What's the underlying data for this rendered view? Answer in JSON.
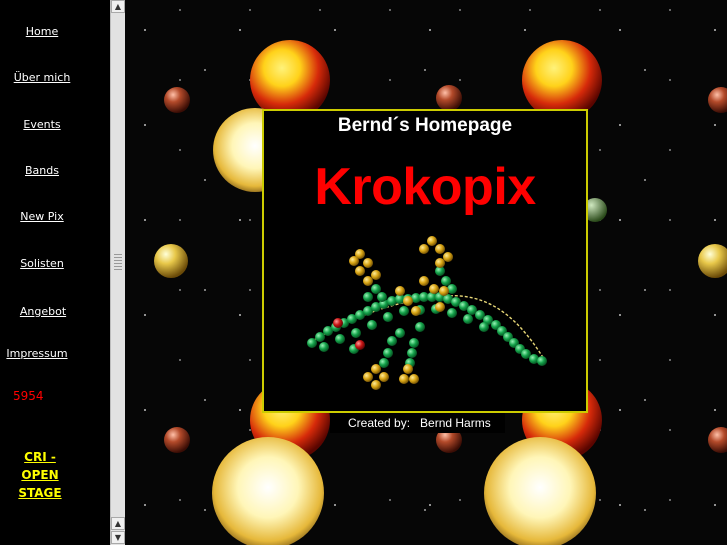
{
  "nav": {
    "items": [
      {
        "label": "Home"
      },
      {
        "label": "Über mich"
      },
      {
        "label": "Events"
      },
      {
        "label": "Bands"
      },
      {
        "label": "New Pix"
      },
      {
        "label": "Solisten"
      },
      {
        "label": "Angebot"
      },
      {
        "label": "Impressum"
      }
    ],
    "counter": "5954",
    "cri_label": "CRI - OPEN STAGE"
  },
  "scrollbar": {
    "up_icon": "scroll-up-arrow-icon",
    "down_icon": "scroll-down-arrow-icon"
  },
  "main": {
    "title": "Bernd´s Homepage",
    "logo_text": "Krokopix",
    "credit": "Created by:   Bernd Harms",
    "colors": {
      "logo": "#ff0000",
      "panel_border": "#cccc00",
      "link": "#ffffff",
      "cri": "#ffff00",
      "counter": "#ff0000"
    }
  }
}
